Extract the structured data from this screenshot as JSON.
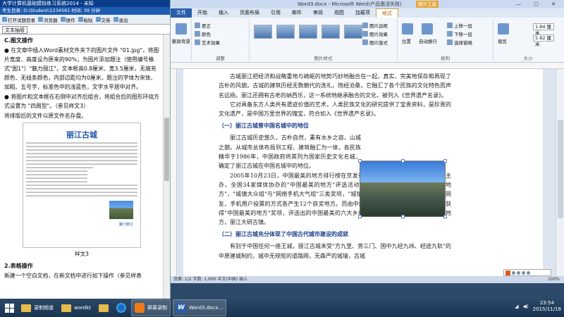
{
  "exam": {
    "title": "大学计算机基础模拟练习系统2014 - 未知",
    "status": "考生目录: D:\\Student\\1234561  时间: 39 分钟",
    "toolbar": [
      "打开试题目录",
      "浏览器",
      "操作",
      "粘贴",
      "交卷",
      "退出"
    ],
    "tab": "文本抽屉",
    "section_c": "C.图文操作",
    "para1": "● 在文章中插入Word素材文件夹下的图片文件 \"01.jpg\"，将图片宽度、高度设为原来的90%；为图片添加题注（使用编号格式\"图1\"）\"魅力丽江\"，文本框高0.8厘米、宽3.5厘米，无填充颜色、无线条颜色，内部边距均为0厘米，题注的字体为宋体、加粗、五号字，标准色中的浅蓝色，文字水平居中对齐。",
    "para2": "● 将图片和文本框在右侧中对齐后组合，将组合后的图形环绕方式设置为 \"四周型\"。（参见样文3）",
    "para3": "将排版后的文件以原文件名存盘。",
    "preview_title": "丽江古城",
    "preview_caption": "魅力丽江",
    "preview_label": "样文3",
    "section2": "2.表格操作",
    "para4": "新建一个空白文档，在新文档中进行如下操作（参见样表"
  },
  "word": {
    "title": "Word3.docx - Microsoft Word(产品激活失败)",
    "picture_tools": "图片工具",
    "window_controls": "— ▢ ✕",
    "tabs": [
      "文件",
      "开始",
      "插入",
      "页面布局",
      "引用",
      "邮件",
      "审阅",
      "视图",
      "加载项",
      "格式"
    ],
    "ribbon": {
      "remove_bg": "删除背景",
      "adjust": [
        "更正",
        "颜色",
        "艺术效果"
      ],
      "adjust_label": "调整",
      "styles_label": "图片样式",
      "style_opts": [
        "图片边框",
        "图片效果",
        "图片版式"
      ],
      "position": "位置",
      "wrap": "自动换行",
      "arrange_opts": [
        "上移一层",
        "下移一层",
        "选择窗格"
      ],
      "arrange_label": "排列",
      "crop": "裁剪",
      "height": "1.84 厘米",
      "width": "5.82 厘米",
      "size_label": "大小"
    },
    "doc": {
      "p1": "古城丽江把经济和战略重地与崎岖的地势巧妙地融合在一起，真实、完美地保存和再现了古朴的风貌。古城的建筑历经无数朝代的洗礼，饱经沧桑，它融汇了各个民族的文化特色而声名远扬。丽江还拥有古老的纳西乐，这一系统地继承融合的文化，被列入《世界遗产名录》。",
      "p2": "它对具备东方人类共有遗迹价值的艺术，人类民族文化的研究提供了宝贵资料，是珍贵的文化遗产，是中国万里世界的瑰宝，符合如入《世界遗产名录》。",
      "h1": "（一）丽江古城曾中国名城中的地位",
      "p3": "丽江古城历史悠久，古朴自然，素有水乡之容、山城之貌。从城市总体布局到工程、建筑融汇为一体，各民族精华于1986年，中国政府将其列为国家历史文化名城，确定了丽江古城在中国名城中的地位。",
      "p4": "2005年10月23日，中国最美的地方排行榜在京发布，此次活动由《中国国家地理》主办，全国34家媒体协办的\"中国最美的地方\"评选活动，历时8个月，评出\"中国最美的地方\"，\"城镇大众组\"与\"网络手机大气组\"三类奖项，\"城镇组\"与\"人气组\"分别以媒体投票及网友、手机用户投票的方式各产生12个获奖地方。而由中国国家地理杂志社主办的丽江古城获得\"中国最美的地方\"奖项，评选出的中国最美的六大乡村古镇中就有入选，在中国最美的地方，丽江大研古镇。",
      "h2": "（二）丽江古城充分体现了中国古代城市建设的成就",
      "p5": "有别于中国任何一座王城，丽江古城未受\"方九里、旁三门、国中九经九纬、经途九轨\"的中原建城制约，城中无规矩的道路网，无森严的城墙，古城"
    },
    "status": "页面: 1/2   字数: 1,690   中文(中国)   插入",
    "zoom": "100%"
  },
  "taskbar": {
    "items": [
      "录制频道",
      "wordkt",
      "屏幕录制",
      "Word3.docx..."
    ],
    "time": "23:54",
    "date": "2015/11/18"
  }
}
